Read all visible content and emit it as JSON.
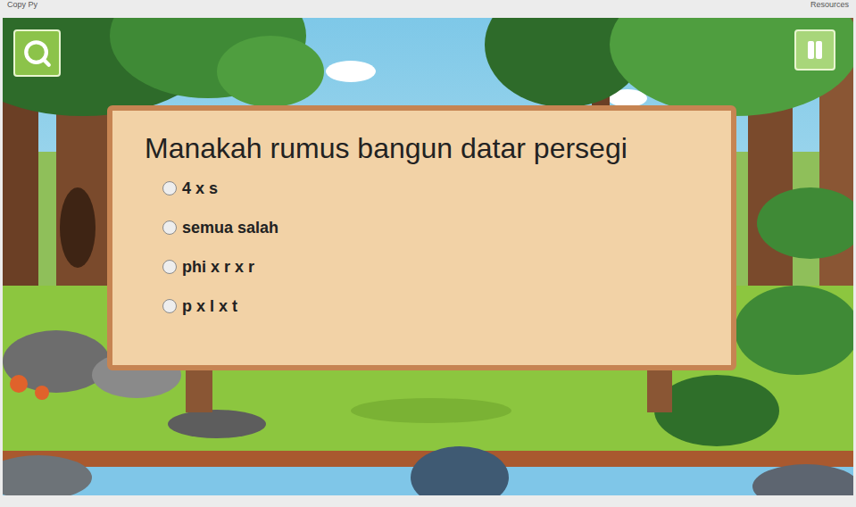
{
  "top_bar": {
    "left": "Copy Py",
    "right": "Resources"
  },
  "quiz": {
    "question": "Manakah rumus bangun datar persegi",
    "options": [
      {
        "label": "4 x s",
        "selected": false
      },
      {
        "label": "semua salah",
        "selected": false
      },
      {
        "label": "phi x r x r",
        "selected": false
      },
      {
        "label": "p x l x t",
        "selected": false
      }
    ]
  }
}
